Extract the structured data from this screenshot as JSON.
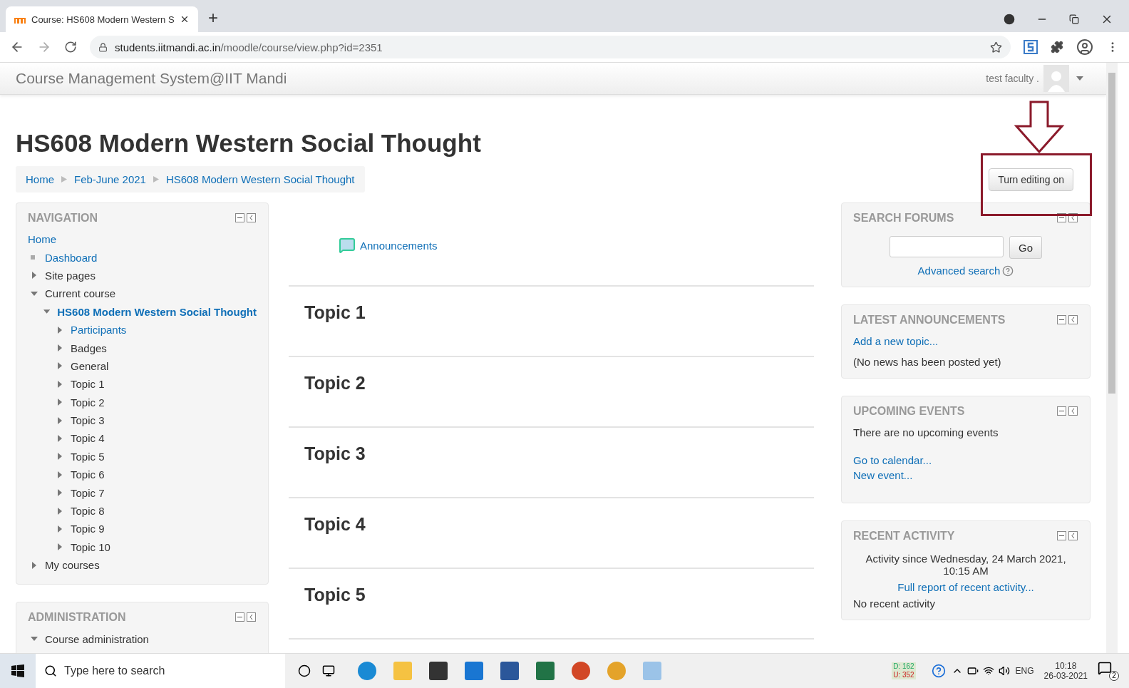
{
  "browser": {
    "tab_title": "Course: HS608 Modern Western S",
    "new_tab": "+",
    "url_host": "students.iitmandi.ac.in",
    "url_path": "/moodle/course/view.php?id=2351"
  },
  "header": {
    "site_name": "Course Management System@IIT Mandi",
    "user_name": "test faculty ."
  },
  "page": {
    "title": "HS608 Modern Western Social Thought",
    "breadcrumb": [
      "Home",
      "Feb-June 2021",
      "HS608 Modern Western Social Thought"
    ],
    "edit_button": "Turn editing on"
  },
  "navigation": {
    "title": "NAVIGATION",
    "items": [
      {
        "label": "Home",
        "kind": "link"
      },
      {
        "label": "Dashboard",
        "kind": "bullet",
        "link": true
      },
      {
        "label": "Site pages",
        "kind": "node",
        "expanded": false
      },
      {
        "label": "Current course",
        "kind": "node",
        "expanded": true,
        "children": [
          {
            "label": "HS608 Modern Western Social Thought",
            "kind": "node",
            "expanded": true,
            "link": true,
            "current": true,
            "children": [
              {
                "label": "Participants",
                "kind": "node",
                "expanded": false,
                "link": true
              },
              {
                "label": "Badges",
                "kind": "node",
                "expanded": false
              },
              {
                "label": "General",
                "kind": "node",
                "expanded": false
              },
              {
                "label": "Topic 1",
                "kind": "node",
                "expanded": false
              },
              {
                "label": "Topic 2",
                "kind": "node",
                "expanded": false
              },
              {
                "label": "Topic 3",
                "kind": "node",
                "expanded": false
              },
              {
                "label": "Topic 4",
                "kind": "node",
                "expanded": false
              },
              {
                "label": "Topic 5",
                "kind": "node",
                "expanded": false
              },
              {
                "label": "Topic 6",
                "kind": "node",
                "expanded": false
              },
              {
                "label": "Topic 7",
                "kind": "node",
                "expanded": false
              },
              {
                "label": "Topic 8",
                "kind": "node",
                "expanded": false
              },
              {
                "label": "Topic 9",
                "kind": "node",
                "expanded": false
              },
              {
                "label": "Topic 10",
                "kind": "node",
                "expanded": false
              }
            ]
          }
        ]
      },
      {
        "label": "My courses",
        "kind": "node",
        "expanded": false
      }
    ]
  },
  "administration": {
    "title": "ADMINISTRATION",
    "items": [
      {
        "label": "Course administration",
        "kind": "node",
        "expanded": true
      }
    ]
  },
  "content": {
    "announcements": "Announcements",
    "topics": [
      "Topic 1",
      "Topic 2",
      "Topic 3",
      "Topic 4",
      "Topic 5"
    ]
  },
  "search_forums": {
    "title": "SEARCH FORUMS",
    "go": "Go",
    "advanced": "Advanced search"
  },
  "latest_announcements": {
    "title": "LATEST ANNOUNCEMENTS",
    "add": "Add a new topic...",
    "empty": "(No news has been posted yet)"
  },
  "upcoming_events": {
    "title": "UPCOMING EVENTS",
    "empty": "There are no upcoming events",
    "links": [
      "Go to calendar...",
      "New event..."
    ]
  },
  "recent_activity": {
    "title": "RECENT ACTIVITY",
    "since": "Activity since Wednesday, 24 March 2021, 10:15 AM",
    "report": "Full report of recent activity...",
    "empty": "No recent activity"
  },
  "taskbar": {
    "search_placeholder": "Type here to search",
    "net_down": "D: 162",
    "net_up": "U: 352",
    "language": "ENG",
    "time": "10:18",
    "date": "26-03-2021",
    "notifications": "2"
  }
}
